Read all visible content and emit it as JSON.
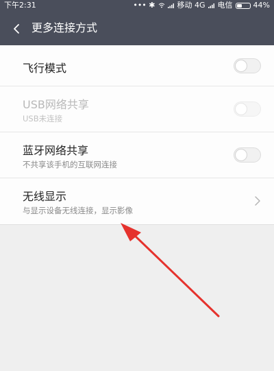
{
  "status_bar": {
    "time": "下午2:31",
    "indicators": "••• ✱ ",
    "carrier1": "移动 4G",
    "carrier2": "电信",
    "battery_percent": "44%",
    "battery_level": 0.44,
    "icons": [
      "bluetooth-icon",
      "wifi-icon",
      "signal-icon",
      "battery-icon"
    ]
  },
  "header": {
    "title": "更多连接方式",
    "back_icon": "chevron-left-icon"
  },
  "settings": {
    "items": [
      {
        "title": "飞行模式",
        "subtitle": "",
        "control": "toggle",
        "state": "off",
        "enabled": true
      },
      {
        "title": "USB网络共享",
        "subtitle": "USB未连接",
        "control": "toggle",
        "state": "off",
        "enabled": false
      },
      {
        "title": "蓝牙网络共享",
        "subtitle": "不共享该手机的互联网连接",
        "control": "toggle",
        "state": "off",
        "enabled": true
      },
      {
        "title": "无线显示",
        "subtitle": "与显示设备无线连接，显示影像",
        "control": "chevron",
        "enabled": true
      }
    ]
  },
  "annotation": {
    "type": "arrow",
    "color": "#e5322d"
  }
}
